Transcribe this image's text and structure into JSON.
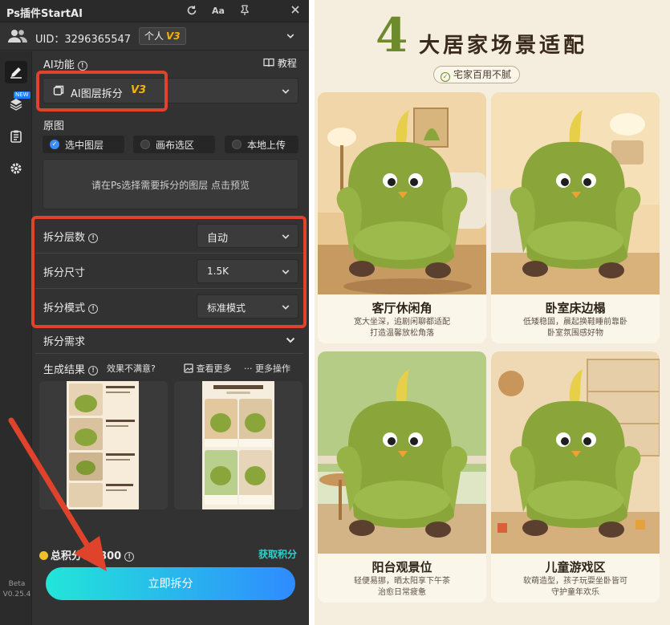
{
  "app": {
    "title": "Ps插件StartAI"
  },
  "user": {
    "uid": "UID：3296365547",
    "plan": "个人",
    "plan_version": "V3"
  },
  "ai_function": {
    "label": "AI功能",
    "tutorial": "教程",
    "selected": "AI图层拆分",
    "selected_version": "V3"
  },
  "source": {
    "label": "原图",
    "options": [
      "选中图层",
      "画布选区",
      "本地上传"
    ],
    "selected": "选中图层",
    "hint": "请在Ps选择需要拆分的图层 点击预览"
  },
  "settings": {
    "layers_label": "拆分层数",
    "layers_value": "自动",
    "size_label": "拆分尺寸",
    "size_value": "1.5K",
    "mode_label": "拆分模式",
    "mode_value": "标准模式",
    "requirement_label": "拆分需求"
  },
  "results": {
    "label": "生成结果",
    "not_satisfied": "效果不满意?",
    "view_more": "查看更多",
    "more_actions": "更多操作"
  },
  "points": {
    "label": "总积分：",
    "value": "9800",
    "get": "获取积分"
  },
  "primary_button": "立即拆分",
  "version": {
    "channel": "Beta",
    "number": "V0.25.4"
  },
  "poster": {
    "number": "4",
    "headline": "大居家场景适配",
    "tag": "宅家百用不腻",
    "scenes": [
      {
        "title": "客厅休闲角",
        "line1": "宽大坐深，追剧闲聊都适配",
        "line2": "打造温馨放松角落"
      },
      {
        "title": "卧室床边榻",
        "line1": "低矮稳固，晨起换鞋睡前靠卧",
        "line2": "卧室氛围感好物"
      },
      {
        "title": "阳台观景位",
        "line1": "轻便易挪，晒太阳享下午茶",
        "line2": "治愈日常疲惫"
      },
      {
        "title": "儿童游戏区",
        "line1": "软萌造型，孩子玩耍坐卧皆可",
        "line2": "守护童年欢乐"
      }
    ]
  },
  "colors": {
    "panel_bg": "#323232",
    "accent_red": "#e0432b",
    "accent_teal": "#22e6d8",
    "accent_blue": "#2f8bff",
    "version_gold": "#f5b400",
    "sofa_green": "#8aa63a"
  },
  "icons": [
    "refresh-icon",
    "font-size-icon",
    "pin-icon",
    "close-icon",
    "users-icon",
    "chevron-down-icon",
    "info-icon",
    "book-icon",
    "edit-icon",
    "layers-icon",
    "clipboard-icon",
    "gear-icon",
    "check-circle-icon",
    "more-icon"
  ]
}
